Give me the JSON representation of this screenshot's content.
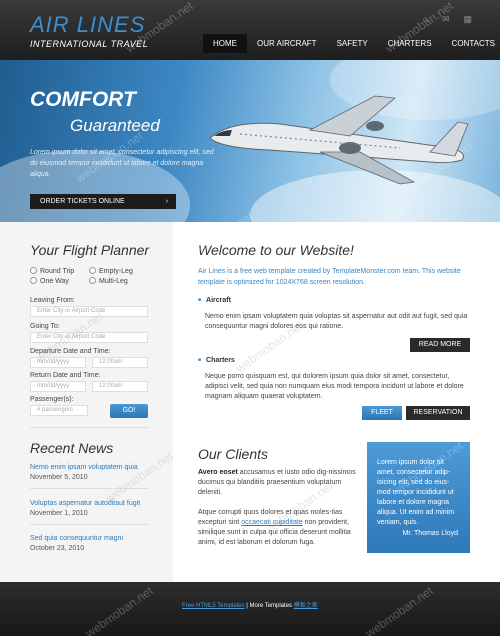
{
  "header": {
    "logo": "AIR LINES",
    "tagline": "INTERNATIONAL TRAVEL",
    "nav": [
      "HOME",
      "OUR AIRCRAFT",
      "SAFETY",
      "CHARTERS",
      "CONTACTS"
    ],
    "active_nav": "HOME"
  },
  "hero": {
    "title": "COMFORT",
    "subtitle": "Guaranteed",
    "text": "Lorem ipsum dolor sit amet, consectetur adipiscing elit, sed do eiusmod tempor incididunt ut labore et dolore magna aliqua.",
    "order_button": "ORDER TICKETS ONLINE"
  },
  "planner": {
    "title": "Your Flight Planner",
    "radio_round": "Round Trip",
    "radio_empty": "Empty-Leg",
    "radio_oneway": "One Way",
    "radio_multi": "Multi-Leg",
    "leaving_label": "Leaving From:",
    "leaving_placeholder": "Enter City or Airport Code",
    "going_label": "Going To:",
    "going_placeholder": "Enter City or Airport Code",
    "departure_label": "Departure Date and Time:",
    "date_placeholder": "mm/dd/yyyy",
    "time_value": "12:00am",
    "return_label": "Return Date and Time:",
    "passengers_label": "Passenger(s):",
    "passengers_placeholder": "# passengers",
    "go_button": "GO!"
  },
  "news": {
    "title": "Recent News",
    "items": [
      {
        "text": "Nemo enim ipsam voluptatem quia",
        "date": "November 5, 2010"
      },
      {
        "text": "Voluptas aspernatur autoditaut fugit",
        "date": "November 1, 2010"
      },
      {
        "text": "Sed quia consequuntur magni",
        "date": "October 23, 2010"
      }
    ]
  },
  "main": {
    "welcome_title": "Welcome to our Website!",
    "intro": "Air Lines is a free web template created by TemplateMonster.com team. This website template is optimized for 1024X768 screen resolution.",
    "aircraft_heading": "Aircraft",
    "aircraft_text": "Nemo enim ipsam voluptatem quia voluptas sit aspernatur aut odit aut fugit, sed quia consequuntur magni dolores eos qui ratione.",
    "read_more": "READ MORE",
    "charters_heading": "Charters",
    "charters_text": "Neque porro quisquam est, qui dolorem ipsum quia dolor sit amet, consectetur, adipisci velit, sed quia non numquam eius modi tempora incidunt ut labore et dolore magnam aliquam quaerat voluptatem.",
    "fleet_button": "FLEET",
    "reservation_button": "RESERVATION",
    "clients_title": "Our Clients",
    "clients_p1_bold": "Avero eoset",
    "clients_p1": " accusamus et iusto odio dig-nissimos ducimus qui blanditiis praesentium voluptatum deleniti.",
    "clients_p2_a": "Atque corrupti quos dolores et quas moles-tias excepturi sint ",
    "clients_p2_link": "occaecati cupiditate",
    "clients_p2_b": " non provident, similique sunt in culpa qui officia deserunt mollitia animi, id est laborum et dolorum fuga.",
    "quote": "Lorem ipsum dolor sit amet, consectetur adip-isicing elit, sed do eius-mod tempor incididunt ut labore et dolore magna aliqua. Ut enim ad minim veniam, quis.",
    "quote_author": "Mr. Thomas Lloyd"
  },
  "footer": {
    "link1": "Free HTML5 Templates",
    "separator": " | ",
    "text2": "More Templates ",
    "link2": "模板之家"
  },
  "watermark": "webmoban.net"
}
